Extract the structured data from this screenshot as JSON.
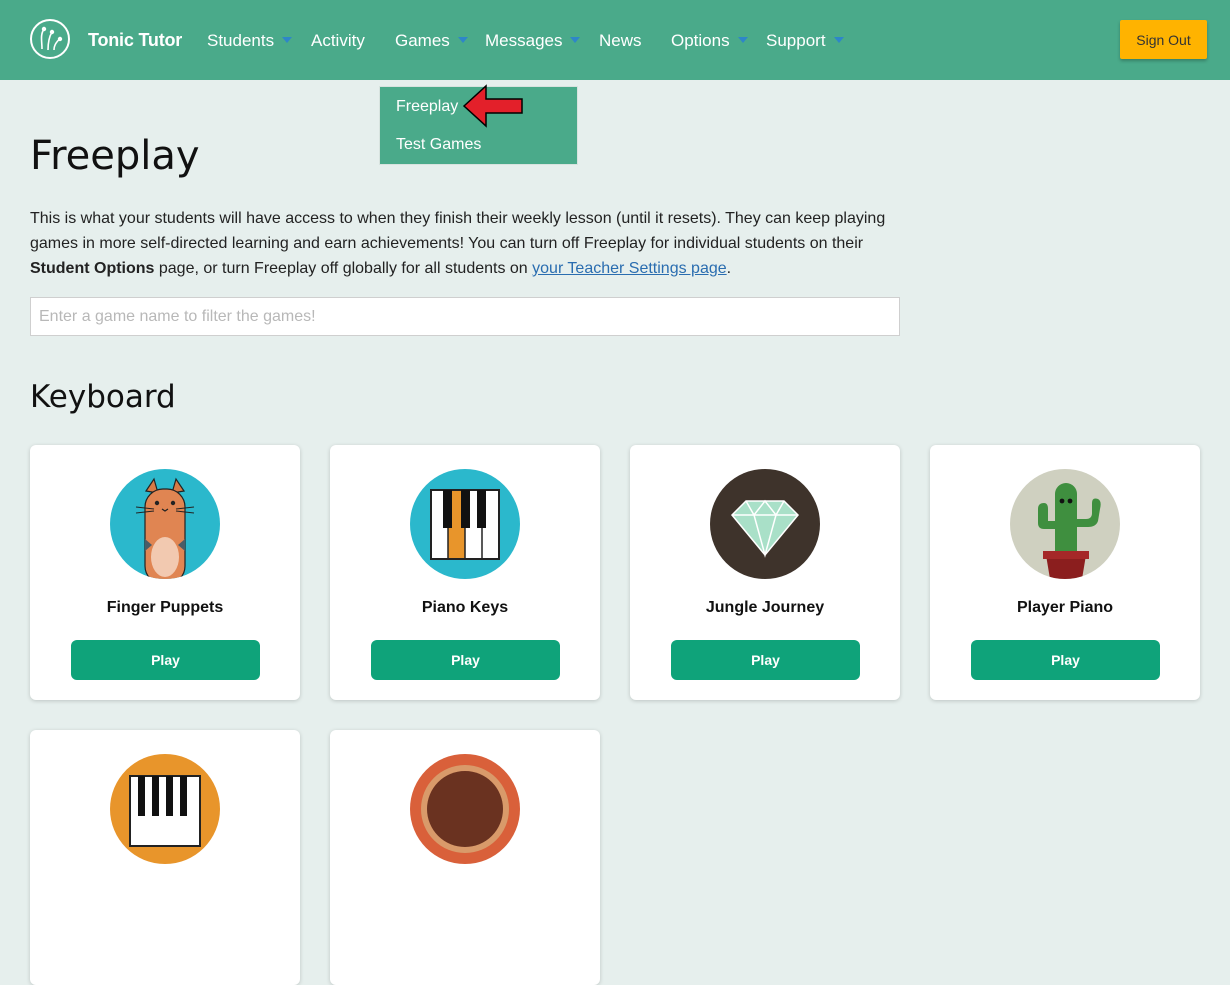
{
  "navbar": {
    "brand": "Tonic Tutor",
    "items": [
      {
        "label": "Students",
        "dropdown": true
      },
      {
        "label": "Activity",
        "dropdown": false
      },
      {
        "label": "Games",
        "dropdown": true
      },
      {
        "label": "Messages",
        "dropdown": true
      },
      {
        "label": "News",
        "dropdown": false
      },
      {
        "label": "Options",
        "dropdown": true
      },
      {
        "label": "Support",
        "dropdown": true
      }
    ],
    "sign_out": "Sign Out"
  },
  "games_menu": {
    "items": [
      "Freeplay",
      "Test Games"
    ]
  },
  "page": {
    "title": "Freeplay",
    "intro_part1": "This is what your students will have access to when they finish their weekly lesson (until it resets). They can keep playing games in more self-directed learning and earn achievements! You can turn off Freeplay for individual students on their ",
    "intro_bold": "Student Options",
    "intro_part2": " page, or turn Freeplay off globally for all students on ",
    "intro_link": "your Teacher Settings page",
    "intro_end": ".",
    "filter_placeholder": "Enter a game name to filter the games!",
    "section_title": "Keyboard"
  },
  "games": [
    {
      "name": "Finger Puppets",
      "play_label": "Play",
      "icon": "cat-puppet-icon"
    },
    {
      "name": "Piano Keys",
      "play_label": "Play",
      "icon": "piano-keys-icon"
    },
    {
      "name": "Jungle Journey",
      "play_label": "Play",
      "icon": "diamond-icon"
    },
    {
      "name": "Player Piano",
      "play_label": "Play",
      "icon": "cactus-icon"
    }
  ],
  "partial_games": [
    {
      "icon": "piano-orange-icon"
    },
    {
      "icon": "drum-icon"
    }
  ],
  "colors": {
    "navbar": "#4aaa8a",
    "page_bg": "#e6efed",
    "sign_out": "#ffb300",
    "play_button": "#0fa37a",
    "link": "#2a6db0",
    "caret": "#2e86c9"
  }
}
